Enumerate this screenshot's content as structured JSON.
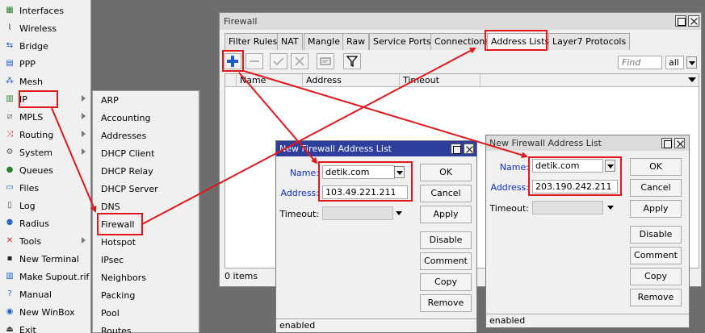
{
  "left_menu": {
    "items": [
      {
        "label": "Interfaces",
        "icon": "interfaces-icon",
        "glyph": "▦",
        "color": "#2e7d32",
        "has_submenu": false
      },
      {
        "label": "Wireless",
        "icon": "wireless-icon",
        "glyph": "⌇",
        "color": "#333333",
        "has_submenu": false
      },
      {
        "label": "Bridge",
        "icon": "bridge-icon",
        "glyph": "⇆",
        "color": "#1e5cc4",
        "has_submenu": false
      },
      {
        "label": "PPP",
        "icon": "ppp-icon",
        "glyph": "▤",
        "color": "#1e5cc4",
        "has_submenu": false
      },
      {
        "label": "Mesh",
        "icon": "mesh-icon",
        "glyph": "⁂",
        "color": "#1e5cc4",
        "has_submenu": false
      },
      {
        "label": "IP",
        "icon": "ip-icon",
        "glyph": "▥",
        "color": "#2e7d32",
        "has_submenu": true
      },
      {
        "label": "MPLS",
        "icon": "mpls-icon",
        "glyph": "⧄",
        "color": "#555555",
        "has_submenu": true
      },
      {
        "label": "Routing",
        "icon": "routing-icon",
        "glyph": "⤨",
        "color": "#c62828",
        "has_submenu": true
      },
      {
        "label": "System",
        "icon": "system-gear-icon",
        "glyph": "⚙",
        "color": "#555555",
        "has_submenu": true
      },
      {
        "label": "Queues",
        "icon": "queues-icon",
        "glyph": "●",
        "color": "#2e7d32",
        "has_submenu": false
      },
      {
        "label": "Files",
        "icon": "files-icon",
        "glyph": "▭",
        "color": "#1e5cc4",
        "has_submenu": false
      },
      {
        "label": "Log",
        "icon": "log-icon",
        "glyph": "▯",
        "color": "#555555",
        "has_submenu": false
      },
      {
        "label": "Radius",
        "icon": "radius-icon",
        "glyph": "⚉",
        "color": "#1e5cc4",
        "has_submenu": false
      },
      {
        "label": "Tools",
        "icon": "tools-icon",
        "glyph": "✕",
        "color": "#c62828",
        "has_submenu": true
      },
      {
        "label": "New Terminal",
        "icon": "terminal-icon",
        "glyph": "▪",
        "color": "#222222",
        "has_submenu": false
      },
      {
        "label": "Make Supout.rif",
        "icon": "supout-icon",
        "glyph": "▥",
        "color": "#1e5cc4",
        "has_submenu": false
      },
      {
        "label": "Manual",
        "icon": "manual-help-icon",
        "glyph": "?",
        "color": "#1e5cc4",
        "has_submenu": false
      },
      {
        "label": "New WinBox",
        "icon": "winbox-icon",
        "glyph": "◉",
        "color": "#1e5cc4",
        "has_submenu": false
      },
      {
        "label": "Exit",
        "icon": "exit-icon",
        "glyph": "⏏",
        "color": "#333333",
        "has_submenu": false
      }
    ]
  },
  "ip_submenu": {
    "items": [
      "ARP",
      "Accounting",
      "Addresses",
      "DHCP Client",
      "DHCP Relay",
      "DHCP Server",
      "DNS",
      "Firewall",
      "Hotspot",
      "IPsec",
      "Neighbors",
      "Packing",
      "Pool",
      "Routes"
    ]
  },
  "firewall": {
    "title": "Firewall",
    "tabs": [
      "Filter Rules",
      "NAT",
      "Mangle",
      "Raw",
      "Service Ports",
      "Connections",
      "Address Lists",
      "Layer7 Protocols"
    ],
    "active_tab": "Address Lists",
    "find_placeholder": "Find",
    "filter_value": "all",
    "columns": [
      "Name",
      "Address",
      "Timeout"
    ],
    "status": "0 items"
  },
  "dialog1": {
    "title": "New Firewall Address List",
    "name_label": "Name:",
    "name_value": "detik.com",
    "address_label": "Address:",
    "address_value": "103.49.221.211",
    "timeout_label": "Timeout:",
    "buttons": [
      "OK",
      "Cancel",
      "Apply",
      "Disable",
      "Comment",
      "Copy",
      "Remove"
    ],
    "status": "enabled"
  },
  "dialog2": {
    "title": "New Firewall Address List",
    "name_label": "Name:",
    "name_value": "detik.com",
    "address_label": "Address:",
    "address_value": "203.190.242.211",
    "timeout_label": "Timeout:",
    "buttons": [
      "OK",
      "Cancel",
      "Apply",
      "Disable",
      "Comment",
      "Copy",
      "Remove"
    ],
    "status": "enabled"
  },
  "colors": {
    "highlight": "#e0181c",
    "active_titlebar": "#2d3e9c",
    "add_button": "#1e5cc4",
    "label_blue": "#0a2ec8"
  }
}
